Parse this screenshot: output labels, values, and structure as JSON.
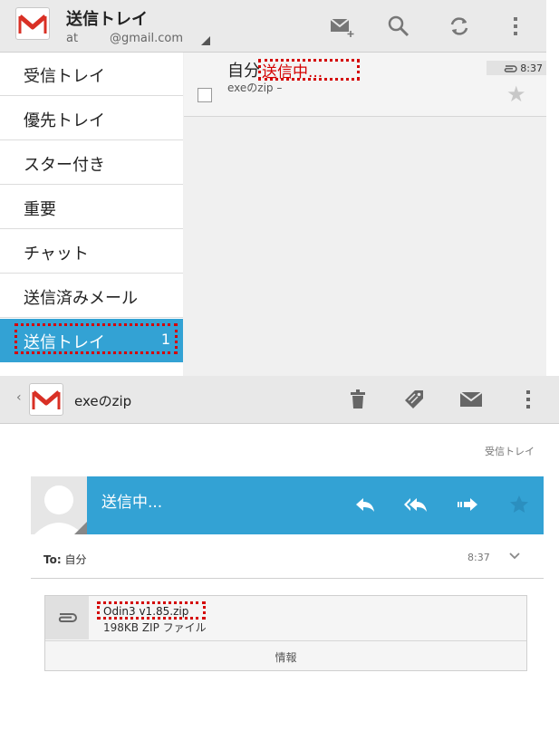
{
  "screen1": {
    "title": "送信トレイ",
    "account_prefix": "at",
    "account_domain": "@gmail.com",
    "toolbar": {
      "compose": "compose-icon",
      "search": "search-icon",
      "refresh": "refresh-icon",
      "menu": "overflow-menu-icon"
    },
    "nav": [
      {
        "label": "受信トレイ"
      },
      {
        "label": "優先トレイ"
      },
      {
        "label": "スター付き"
      },
      {
        "label": "重要"
      },
      {
        "label": "チャット"
      },
      {
        "label": "送信済みメール"
      },
      {
        "label": "送信トレイ",
        "count": "1",
        "selected": true
      }
    ],
    "message": {
      "sender": "自分",
      "status": "送信中...",
      "snippet": "exeのzip –",
      "time": "8:37"
    }
  },
  "screen2": {
    "subject": "exeのzip",
    "back": "‹",
    "folder": "受信トレイ",
    "status": "送信中...",
    "to_label": "To:",
    "to_value": "自分",
    "time": "8:37",
    "attachment": {
      "name": "Odin3 v1.85.zip",
      "meta": "198KB ZIP ファイル",
      "info": "情報"
    }
  },
  "colors": {
    "accent": "#33a2d4",
    "highlight": "#d40000",
    "gmail_red": "#d93025"
  }
}
